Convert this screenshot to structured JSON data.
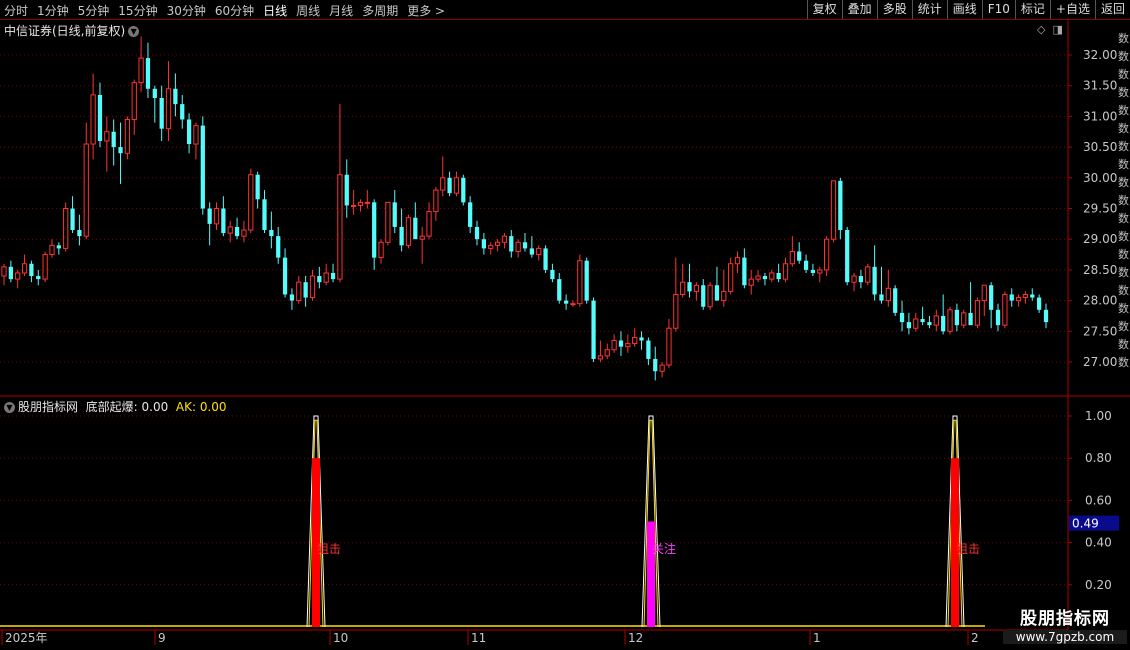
{
  "toolbar": {
    "periods": [
      "分时",
      "1分钟",
      "5分钟",
      "15分钟",
      "30分钟",
      "60分钟",
      "日线",
      "周线",
      "月线",
      "多周期",
      "更多 >"
    ],
    "active_period": "日线",
    "right_buttons": [
      "复权",
      "叠加",
      "多股",
      "统计",
      "画线",
      "F10",
      "标记",
      "+自选",
      "返回"
    ]
  },
  "main_chart": {
    "title": "中信证券(日线,前复权)",
    "price_labels": [
      "32.00",
      "31.50",
      "31.00",
      "30.50",
      "30.00",
      "29.50",
      "29.00",
      "28.50",
      "28.00",
      "27.50",
      "27.00"
    ]
  },
  "indicator": {
    "name": "股朋指标网",
    "line1_label": "底部起爆:",
    "line1_value": "0.00",
    "line2_label": "AK:",
    "line2_value": "0.00",
    "scale_labels": [
      "1.00",
      "0.80",
      "0.60",
      "0.40",
      "0.20"
    ],
    "cursor_value": "0.49",
    "signals": [
      {
        "label": "狙击",
        "value": 0.8,
        "color": "#ff0000"
      },
      {
        "label": "关注",
        "value": 0.5,
        "color": "#ff00ff"
      },
      {
        "label": "狙击",
        "value": 0.8,
        "color": "#ff0000"
      }
    ]
  },
  "date_axis": {
    "labels": [
      "2025年",
      "9",
      "10",
      "11",
      "12",
      "1",
      "2"
    ]
  },
  "watermark": {
    "line1": "股朋指标网",
    "line2": "www.7gpzb.com"
  },
  "colors": {
    "up": "#ff3232",
    "down": "#54fcfc",
    "grid": "#7a0000",
    "axis": "#b00000"
  },
  "chart_data": {
    "type": "candlestick",
    "title": "中信证券(日线,前复权)",
    "ylim": [
      26.65,
      32.55
    ],
    "ohlc": [
      [
        28.4,
        28.6,
        28.25,
        28.55
      ],
      [
        28.55,
        28.65,
        28.3,
        28.35
      ],
      [
        28.35,
        28.5,
        28.2,
        28.45
      ],
      [
        28.45,
        28.75,
        28.4,
        28.6
      ],
      [
        28.6,
        28.65,
        28.3,
        28.4
      ],
      [
        28.4,
        28.5,
        28.25,
        28.35
      ],
      [
        28.35,
        28.8,
        28.3,
        28.75
      ],
      [
        28.75,
        29.0,
        28.7,
        28.9
      ],
      [
        28.9,
        28.95,
        28.75,
        28.85
      ],
      [
        28.85,
        29.6,
        28.8,
        29.5
      ],
      [
        29.5,
        29.7,
        29.1,
        29.15
      ],
      [
        29.15,
        29.4,
        28.9,
        29.05
      ],
      [
        29.05,
        30.9,
        29.0,
        30.55
      ],
      [
        30.55,
        31.7,
        30.3,
        31.35
      ],
      [
        31.35,
        31.55,
        30.5,
        30.6
      ],
      [
        30.6,
        31.0,
        30.1,
        30.75
      ],
      [
        30.75,
        30.95,
        30.2,
        30.5
      ],
      [
        30.5,
        30.9,
        29.9,
        30.4
      ],
      [
        30.4,
        31.0,
        30.3,
        30.95
      ],
      [
        30.95,
        31.6,
        30.7,
        31.55
      ],
      [
        31.55,
        32.3,
        31.4,
        31.95
      ],
      [
        31.95,
        32.2,
        31.3,
        31.45
      ],
      [
        31.45,
        31.5,
        30.9,
        31.3
      ],
      [
        31.3,
        31.5,
        30.6,
        30.8
      ],
      [
        30.8,
        31.9,
        30.6,
        31.45
      ],
      [
        31.45,
        31.7,
        31.0,
        31.2
      ],
      [
        31.2,
        31.35,
        30.8,
        30.95
      ],
      [
        30.95,
        31.05,
        30.4,
        30.55
      ],
      [
        30.55,
        30.9,
        30.3,
        30.85
      ],
      [
        30.85,
        31.0,
        29.4,
        29.5
      ],
      [
        29.5,
        29.6,
        28.9,
        29.25
      ],
      [
        29.25,
        29.6,
        29.15,
        29.5
      ],
      [
        29.5,
        29.7,
        29.05,
        29.1
      ],
      [
        29.1,
        29.3,
        28.95,
        29.2
      ],
      [
        29.2,
        29.35,
        29.0,
        29.05
      ],
      [
        29.05,
        29.3,
        28.95,
        29.15
      ],
      [
        29.15,
        30.15,
        29.1,
        30.05
      ],
      [
        30.05,
        30.1,
        29.5,
        29.65
      ],
      [
        29.65,
        29.8,
        29.1,
        29.15
      ],
      [
        29.15,
        29.45,
        28.85,
        29.05
      ],
      [
        29.05,
        29.2,
        28.6,
        28.7
      ],
      [
        28.7,
        28.85,
        28.05,
        28.1
      ],
      [
        28.1,
        28.2,
        27.85,
        28.0
      ],
      [
        28.0,
        28.4,
        27.95,
        28.3
      ],
      [
        28.3,
        28.4,
        27.9,
        28.05
      ],
      [
        28.05,
        28.5,
        28.0,
        28.4
      ],
      [
        28.4,
        28.55,
        28.2,
        28.3
      ],
      [
        28.3,
        28.6,
        28.25,
        28.45
      ],
      [
        28.45,
        28.6,
        28.3,
        28.35
      ],
      [
        28.35,
        31.2,
        28.3,
        30.05
      ],
      [
        30.05,
        30.3,
        29.35,
        29.55
      ],
      [
        29.55,
        29.8,
        29.4,
        29.55
      ],
      [
        29.55,
        29.65,
        29.45,
        29.6
      ],
      [
        29.6,
        29.8,
        29.5,
        29.6
      ],
      [
        29.6,
        29.65,
        28.5,
        28.7
      ],
      [
        28.7,
        29.0,
        28.6,
        28.95
      ],
      [
        28.95,
        29.45,
        28.9,
        29.6
      ],
      [
        29.6,
        29.8,
        29.1,
        29.2
      ],
      [
        29.2,
        29.5,
        28.8,
        28.9
      ],
      [
        28.9,
        29.4,
        28.85,
        29.35
      ],
      [
        29.35,
        29.6,
        29.2,
        29.0
      ],
      [
        29.0,
        29.2,
        28.6,
        29.05
      ],
      [
        29.05,
        29.6,
        29.0,
        29.45
      ],
      [
        29.45,
        29.85,
        29.3,
        29.8
      ],
      [
        29.8,
        30.35,
        29.7,
        30.0
      ],
      [
        30.0,
        30.1,
        29.7,
        29.75
      ],
      [
        29.75,
        30.1,
        29.7,
        30.0
      ],
      [
        30.0,
        30.05,
        29.55,
        29.6
      ],
      [
        29.6,
        29.7,
        29.1,
        29.2
      ],
      [
        29.2,
        29.3,
        28.9,
        29.0
      ],
      [
        29.0,
        29.1,
        28.75,
        28.85
      ],
      [
        28.85,
        28.95,
        28.75,
        28.9
      ],
      [
        28.9,
        29.0,
        28.8,
        28.95
      ],
      [
        28.95,
        29.1,
        28.85,
        29.05
      ],
      [
        29.05,
        29.15,
        28.7,
        28.8
      ],
      [
        28.8,
        29.0,
        28.7,
        28.95
      ],
      [
        28.95,
        29.1,
        28.8,
        28.85
      ],
      [
        28.85,
        29.05,
        28.7,
        28.75
      ],
      [
        28.75,
        28.9,
        28.65,
        28.85
      ],
      [
        28.85,
        28.9,
        28.45,
        28.5
      ],
      [
        28.5,
        28.6,
        28.3,
        28.35
      ],
      [
        28.35,
        28.45,
        27.95,
        28.0
      ],
      [
        28.0,
        28.1,
        27.85,
        27.95
      ],
      [
        27.95,
        28.0,
        27.9,
        27.95
      ],
      [
        27.95,
        28.75,
        27.9,
        28.65
      ],
      [
        28.65,
        28.7,
        27.95,
        28.0
      ],
      [
        28.0,
        28.05,
        27.0,
        27.05
      ],
      [
        27.05,
        27.35,
        27.0,
        27.1
      ],
      [
        27.1,
        27.3,
        27.05,
        27.2
      ],
      [
        27.2,
        27.45,
        27.15,
        27.35
      ],
      [
        27.35,
        27.5,
        27.1,
        27.25
      ],
      [
        27.25,
        27.45,
        27.15,
        27.3
      ],
      [
        27.3,
        27.55,
        27.25,
        27.4
      ],
      [
        27.4,
        27.5,
        27.2,
        27.35
      ],
      [
        27.35,
        27.4,
        26.95,
        27.05
      ],
      [
        27.05,
        27.25,
        26.7,
        26.85
      ],
      [
        26.85,
        27.0,
        26.75,
        26.95
      ],
      [
        26.95,
        27.7,
        26.9,
        27.55
      ],
      [
        27.55,
        28.7,
        27.5,
        28.1
      ],
      [
        28.1,
        28.6,
        28.05,
        28.3
      ],
      [
        28.3,
        28.6,
        28.05,
        28.15
      ],
      [
        28.15,
        28.3,
        28.0,
        28.25
      ],
      [
        28.25,
        28.35,
        27.85,
        27.9
      ],
      [
        27.9,
        28.3,
        27.85,
        28.25
      ],
      [
        28.25,
        28.55,
        28.1,
        28.0
      ],
      [
        28.0,
        28.5,
        27.9,
        28.15
      ],
      [
        28.15,
        28.7,
        28.1,
        28.6
      ],
      [
        28.6,
        28.8,
        28.45,
        28.7
      ],
      [
        28.7,
        28.85,
        28.2,
        28.25
      ],
      [
        28.25,
        28.5,
        28.1,
        28.35
      ],
      [
        28.35,
        28.5,
        28.3,
        28.4
      ],
      [
        28.4,
        28.45,
        28.25,
        28.35
      ],
      [
        28.35,
        28.5,
        28.3,
        28.45
      ],
      [
        28.45,
        28.6,
        28.3,
        28.35
      ],
      [
        28.35,
        28.7,
        28.3,
        28.6
      ],
      [
        28.6,
        29.05,
        28.55,
        28.8
      ],
      [
        28.8,
        28.95,
        28.6,
        28.65
      ],
      [
        28.65,
        28.75,
        28.45,
        28.5
      ],
      [
        28.5,
        28.6,
        28.4,
        28.45
      ],
      [
        28.45,
        28.55,
        28.3,
        28.5
      ],
      [
        28.5,
        29.05,
        28.4,
        29.0
      ],
      [
        29.0,
        29.95,
        28.95,
        29.95
      ],
      [
        29.95,
        30.0,
        29.0,
        29.15
      ],
      [
        29.15,
        29.2,
        28.25,
        28.3
      ],
      [
        28.3,
        28.45,
        28.15,
        28.4
      ],
      [
        28.4,
        28.5,
        28.2,
        28.3
      ],
      [
        28.3,
        28.6,
        28.25,
        28.55
      ],
      [
        28.55,
        28.9,
        28.0,
        28.1
      ],
      [
        28.1,
        28.55,
        27.95,
        28.0
      ],
      [
        28.0,
        28.5,
        27.9,
        28.2
      ],
      [
        28.2,
        28.25,
        27.75,
        27.8
      ],
      [
        27.8,
        28.0,
        27.5,
        27.65
      ],
      [
        27.65,
        27.8,
        27.45,
        27.55
      ],
      [
        27.55,
        27.8,
        27.5,
        27.7
      ],
      [
        27.7,
        27.9,
        27.6,
        27.65
      ],
      [
        27.65,
        27.75,
        27.55,
        27.6
      ],
      [
        27.6,
        27.85,
        27.5,
        27.75
      ],
      [
        27.75,
        28.1,
        27.45,
        27.5
      ],
      [
        27.5,
        27.9,
        27.45,
        27.85
      ],
      [
        27.85,
        27.95,
        27.5,
        27.6
      ],
      [
        27.6,
        27.85,
        27.55,
        27.8
      ],
      [
        27.8,
        28.3,
        27.7,
        27.6
      ],
      [
        27.6,
        28.05,
        27.55,
        28.0
      ],
      [
        28.0,
        28.25,
        27.75,
        28.25
      ],
      [
        28.25,
        28.3,
        27.55,
        27.85
      ],
      [
        27.85,
        27.95,
        27.5,
        27.6
      ],
      [
        27.6,
        28.15,
        27.55,
        28.1
      ],
      [
        28.1,
        28.2,
        27.9,
        28.0
      ],
      [
        28.0,
        28.1,
        27.9,
        28.05
      ],
      [
        28.05,
        28.15,
        27.95,
        28.1
      ],
      [
        28.1,
        28.2,
        28.0,
        28.05
      ],
      [
        28.05,
        28.1,
        27.8,
        27.85
      ],
      [
        27.85,
        27.95,
        27.55,
        27.65
      ]
    ]
  }
}
